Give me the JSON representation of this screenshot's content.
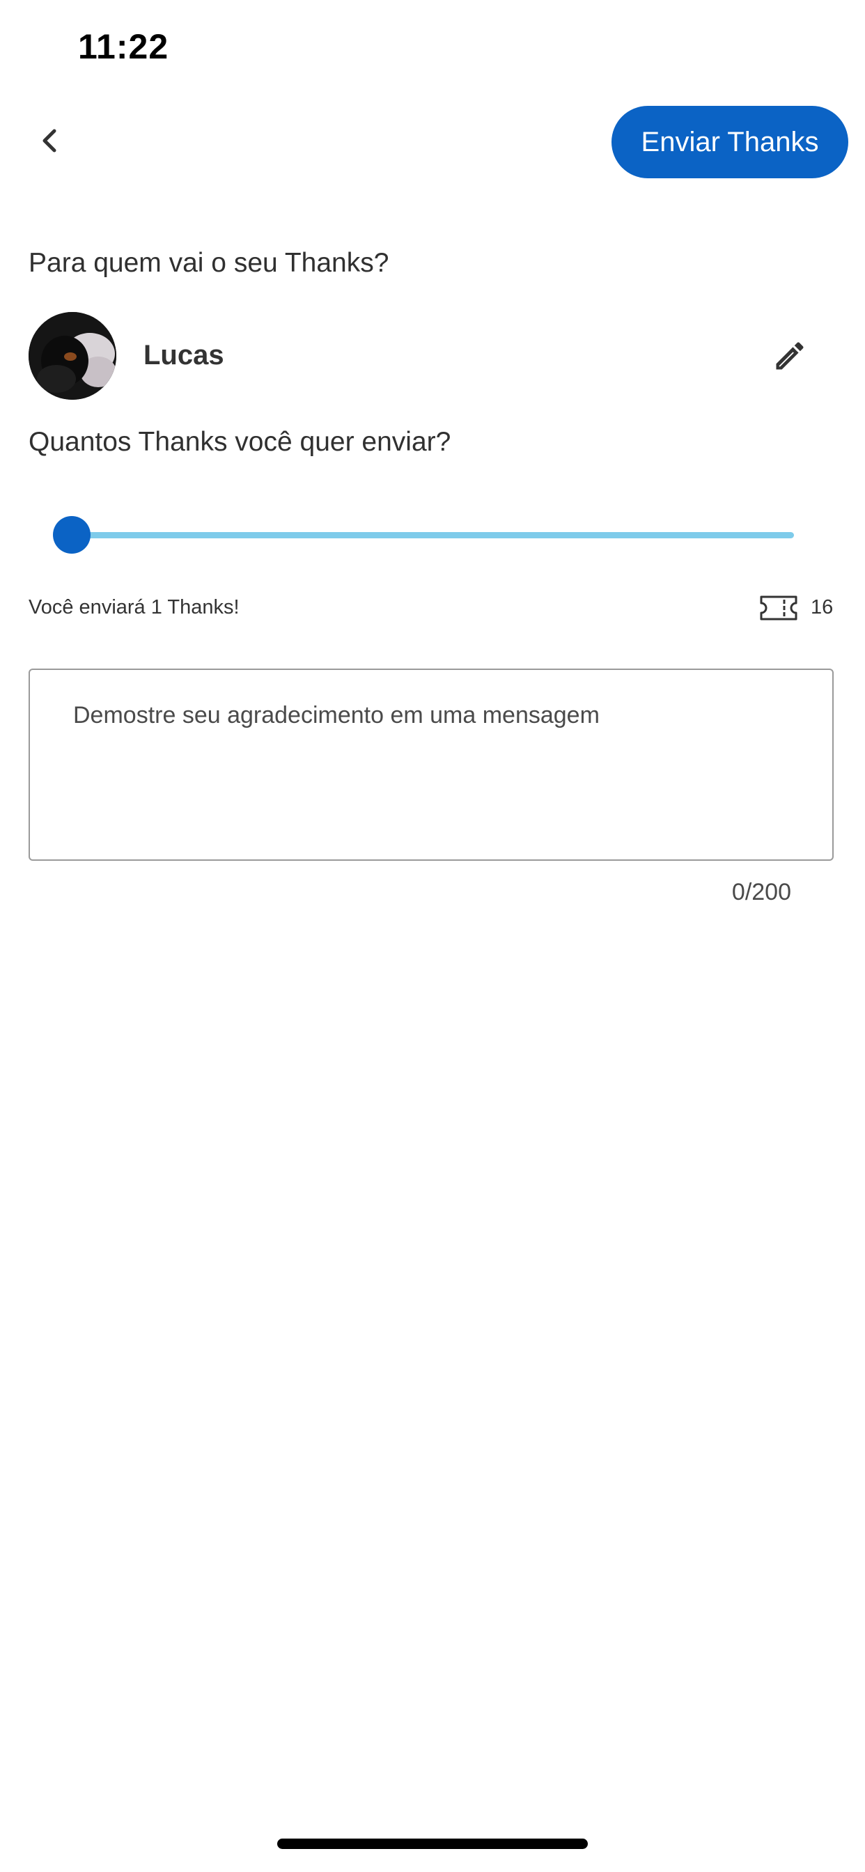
{
  "status_bar": {
    "time": "11:22"
  },
  "header": {
    "back_icon": "chevron-left-icon",
    "send_button_label": "Enviar Thanks"
  },
  "recipient": {
    "question": "Para quem vai o seu Thanks?",
    "name": "Lucas",
    "edit_icon": "pencil-icon"
  },
  "amount": {
    "question": "Quantos Thanks você quer enviar?",
    "slider_value": 1,
    "slider_min": 1,
    "slider_max": 16,
    "summary": "Você enviará 1 Thanks!",
    "balance_icon": "ticket-icon",
    "balance": "16"
  },
  "message": {
    "placeholder": "Demostre seu agradecimento em uma mensagem",
    "counter": "0/200"
  },
  "colors": {
    "primary": "#0b63c5",
    "slider_track": "#7ecbea",
    "text": "#2f2f2f"
  }
}
